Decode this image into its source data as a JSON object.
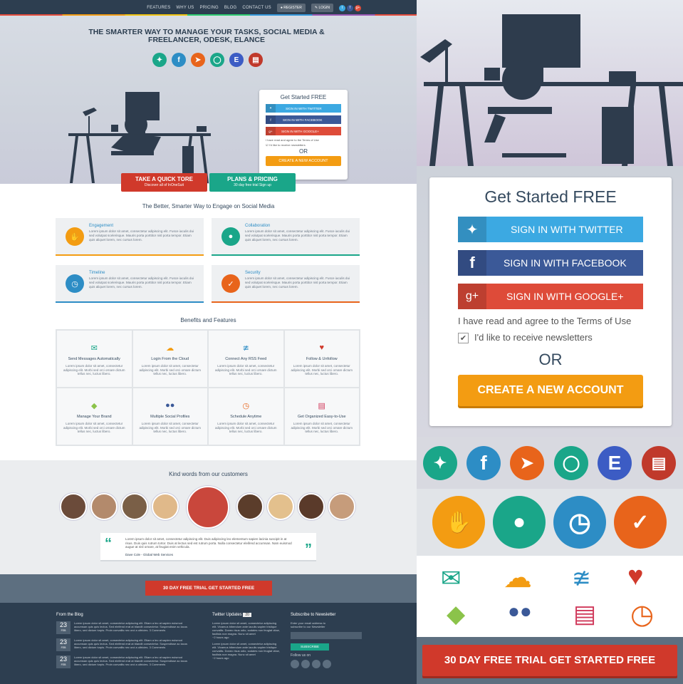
{
  "nav": {
    "items": [
      "FEATURES",
      "WHY US",
      "PRICING",
      "BLOG",
      "CONTACT US"
    ],
    "register": "REGISTER",
    "login": "LOGIN",
    "social": [
      "t",
      "f",
      "g+"
    ]
  },
  "hero": {
    "title": "THE SMARTER WAY TO MANAGE YOUR TASKS, SOCIAL MEDIA & FREELANCER, ODESK, ELANCE"
  },
  "signup": {
    "title": "Get Started FREE",
    "twitter": "SIGN IN WITH TWITTER",
    "facebook": "SIGN IN WITH FACEBOOK",
    "google": "SIGN IN WITH GOOGLE+",
    "terms": "I have read and agree to the Terms of Use",
    "newsletter": "I'd like to receive newsletters",
    "or": "OR",
    "create": "CREATE A NEW ACCOUNT"
  },
  "tour": {
    "label": "TAKE A QUICK TORE",
    "sub": "Discover all of InOneSuit"
  },
  "plans": {
    "label": "PLANS & PRICING",
    "sub": "30 day free trial Sign up"
  },
  "engage": {
    "title": "The Better, Smarter Way to Engage on Social Media",
    "items": [
      {
        "title": "Engagement",
        "text": "Lorem ipsum dolor sit amet, consectetur adipiscing elit. Fusce iaculis dui sed volutpat scelerisque. Mauris porta porttitor nisl porta tempor. Etiam quis aliquet lorem, nec cursus lorem."
      },
      {
        "title": "Collaboration",
        "text": "Lorem ipsum dolor sit amet, consectetur adipiscing elit. Fusce iaculis dui sed volutpat scelerisque. Mauris porta porttitor nisl porta tempor. Etiam quis aliquet lorem, nec cursus lorem."
      },
      {
        "title": "Timeline",
        "text": "Lorem ipsum dolor sit amet, consectetur adipiscing elit. Fusce iaculis dui sed volutpat scelerisque. Mauris porta porttitor nisl porta tempor. Etiam quis aliquet lorem, nec cursus lorem."
      },
      {
        "title": "Security",
        "text": "Lorem ipsum dolor sit amet, consectetur adipiscing elit. Fusce iaculis dui sed volutpat scelerisque. Mauris porta porttitor nisl porta tempor. Etiam quis aliquet lorem, nec cursus lorem."
      }
    ]
  },
  "benefits": {
    "title": "Benefits and Features",
    "text": "Lorem ipsum dolor sit amet, consectetur adipiscing elit. Morbi sed orci ornare dictum tellus nec, luctus libero.",
    "items": [
      "Send Messages Automatically",
      "Login From the Cloud",
      "Connect Any RSS Feed",
      "Follow & Unfollow",
      "Manage Your Brand",
      "Multiple Social Profiles",
      "Schedule Anytime",
      "Get Organized Easy-to-Use"
    ]
  },
  "kind": {
    "title": "Kind words from our customers",
    "quote": "Lorem ipsum dolor sit amet, consectetur adipiscing elit. Duis adipiscing leo elementum sapien lacinia suscipit in at risus. Duis quis rutrum tortor. Duis at lectus sed est rutrum porta. Nulla consectetur eleifend accumsan. Nam euismod augue at nisl ornare, at feugiat enim vehicula.",
    "author": "Dave Cole - Global Web Services"
  },
  "cta": "30 DAY FREE TRIAL GET STARTED FREE",
  "footer": {
    "blog_title": "From the Blog",
    "blog": [
      {
        "day": "23",
        "mon": "FEB",
        "text": "Lorem ipsum dolor sit amet, consectetur adipiscing elit. Etiam a leo at sapien euismod accumsan quis quis lectus. Sed eleifend erat at blandit consectetur. Suspendisse ac lacus libero, sed dictum turpis. Proin convallis nec orci a ultricies.",
        "comments": "3 Comments"
      },
      {
        "day": "23",
        "mon": "FEB",
        "text": "Lorem ipsum dolor sit amet, consectetur adipiscing elit. Etiam a leo at sapien euismod accumsan quis quis lectus. Sed eleifend erat at blandit consectetur. Suspendisse ac lacus libero, sed dictum turpis. Proin convallis nec orci a ultricies.",
        "comments": "3 Comments"
      },
      {
        "day": "23",
        "mon": "FEB",
        "text": "Lorem ipsum dolor sit amet, consectetur adipiscing elit. Etiam a leo at sapien euismod accumsan quis quis lectus. Sed eleifend erat at blandit consectetur. Suspendisse ac lacus libero, sed dictum turpis. Proin convallis nec orci a ultricies.",
        "comments": "3 Comments"
      }
    ],
    "tw_title": "Twitter Updates",
    "tw_count": "20",
    "tweets": [
      {
        "text": "Lorem ipsum dolor sit amet, consectetur adipiscing elit. Vivamus bibendum ante iaculis sapien tristique convallis. Donec risus odio, sodales non feugiat vitae, facilisis non magna. Nunc sit amet",
        "time": "~2 hours ago"
      },
      {
        "text": "Lorem ipsum dolor sit amet, consectetur adipiscing elit. Vivamus bibendum ante iaculis sapien tristique convallis. Donec risus odio, sodales non feugiat vitae, facilisis non magna. Nunc sit amet",
        "time": "~2 hours ago"
      }
    ],
    "sub_title": "Subscribe to Newsletter",
    "sub_text": "Enter your email address to subscribe to our Newsletter",
    "sub_btn": "SUBSCRIBE",
    "follow": "Follow us on"
  },
  "colors": {
    "navy": "#2d3e50",
    "twitter": "#3ca9e2",
    "facebook": "#3b5998",
    "google": "#de4b39",
    "orange": "#f39c12",
    "red": "#d0392b",
    "green": "#1aa689"
  }
}
